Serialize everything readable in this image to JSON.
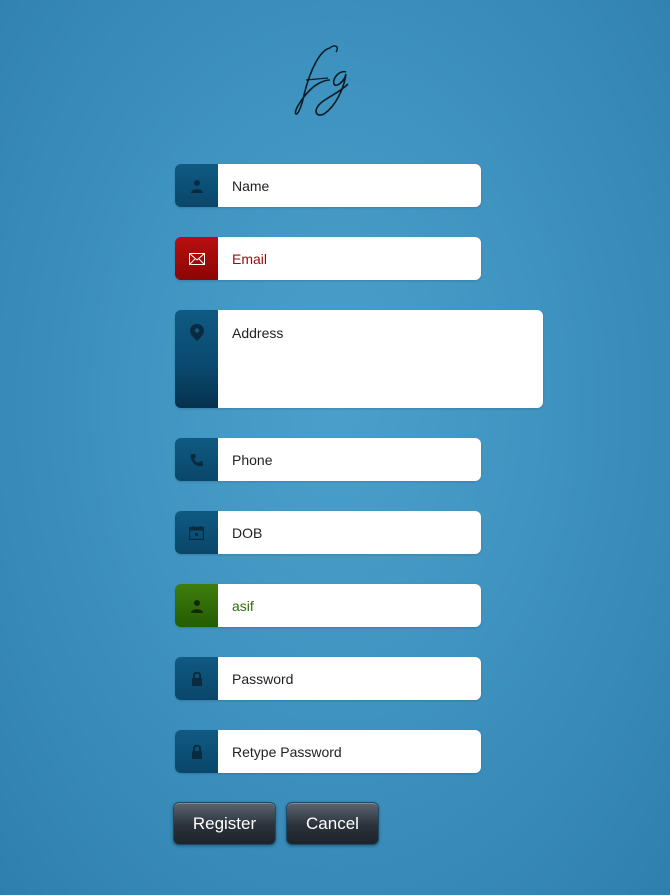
{
  "form": {
    "fields": [
      {
        "placeholder": "Name",
        "icon": "user-icon",
        "state": "default"
      },
      {
        "placeholder": "Email",
        "icon": "envelope-icon",
        "state": "error"
      },
      {
        "placeholder": "Address",
        "icon": "map-pin-icon",
        "state": "default"
      },
      {
        "placeholder": "Phone",
        "icon": "phone-icon",
        "state": "default"
      },
      {
        "placeholder": "DOB",
        "icon": "calendar-icon",
        "state": "default"
      },
      {
        "value": "asif",
        "icon": "user-icon",
        "state": "valid"
      },
      {
        "placeholder": "Password",
        "icon": "lock-icon",
        "state": "default"
      },
      {
        "placeholder": "Retype Password",
        "icon": "lock-icon",
        "state": "default"
      }
    ],
    "register_label": "Register",
    "cancel_label": "Cancel"
  },
  "colors": {
    "background": "#3f93c0",
    "icon_default": "#0b4a70",
    "icon_error": "#a30a0a",
    "icon_valid": "#357408",
    "error_text": "#9a0d0d",
    "valid_text": "#2e6c05"
  }
}
